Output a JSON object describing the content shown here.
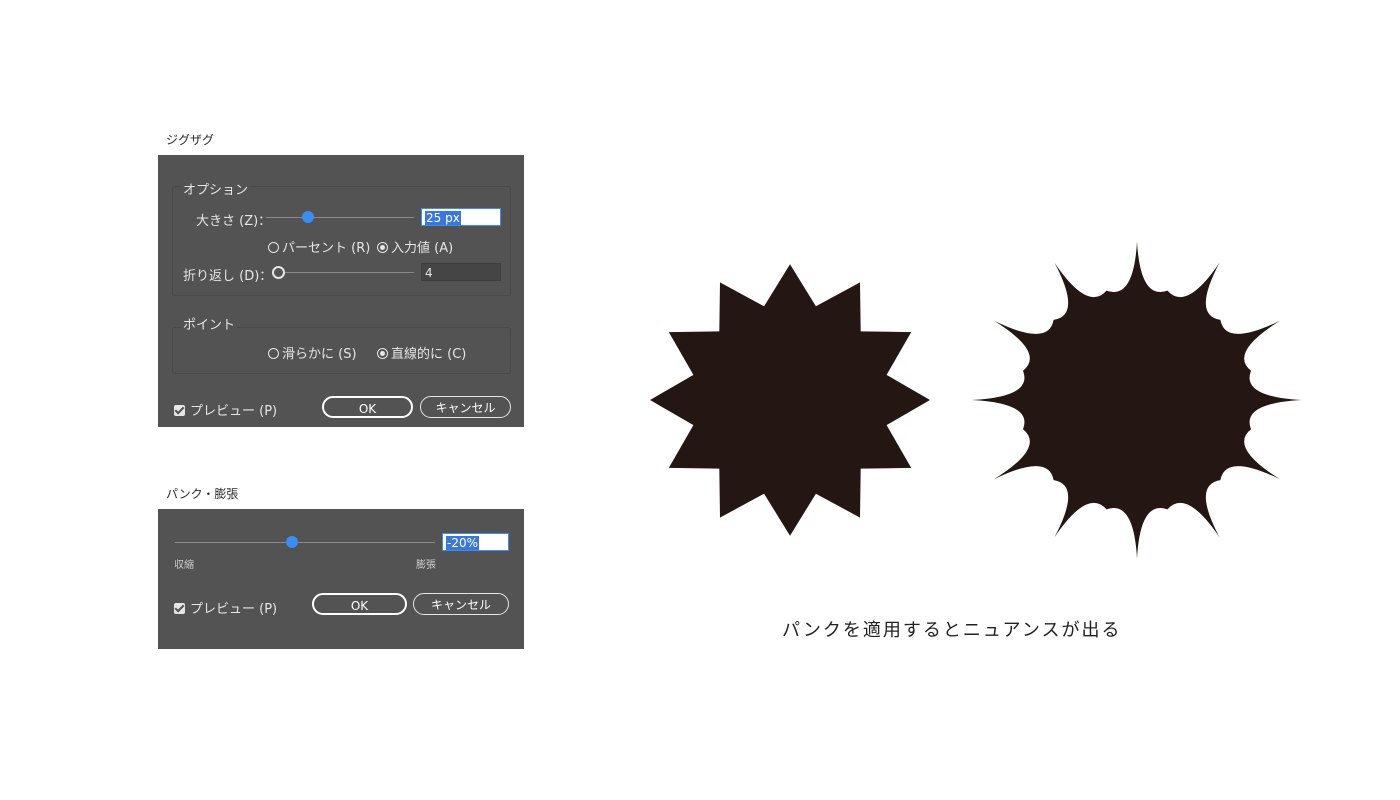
{
  "zigzag_dialog": {
    "title": "ジグザグ",
    "options_group_label": "オプション",
    "size_label": "大きさ (Z)：",
    "size_value": "25 px",
    "radio_percent": "パーセント (R)",
    "radio_absolute": "入力値 (A)",
    "ridges_label": "折り返し (D)：",
    "ridges_value": "4",
    "points_group_label": "ポイント",
    "radio_smooth": "滑らかに (S)",
    "radio_corner": "直線的に (C)",
    "preview_label": "プレビュー (P)",
    "ok_label": "OK",
    "cancel_label": "キャンセル"
  },
  "pucker_dialog": {
    "title": "パンク・膨張",
    "value": "-20%",
    "left_label": "収縮",
    "right_label": "膨張",
    "preview_label": "プレビュー (P)",
    "ok_label": "OK",
    "cancel_label": "キャンセル"
  },
  "caption": "パンクを適用するとニュアンスが出る",
  "colors": {
    "dialog_bg": "#535353",
    "accent": "#3a8ef0",
    "shape_fill": "#241713"
  }
}
